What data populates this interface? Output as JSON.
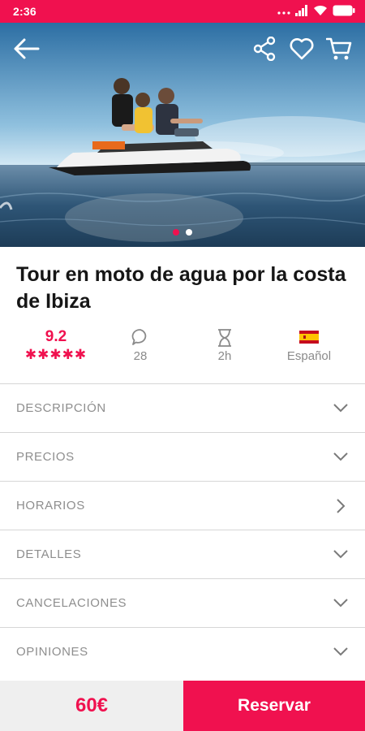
{
  "status_bar": {
    "time": "2:36",
    "bg_color": "#f0114f"
  },
  "hero": {
    "icons": [
      "back-arrow-icon",
      "share-icon",
      "heart-icon",
      "cart-icon"
    ],
    "slides_total": 2,
    "active_slide": 1
  },
  "title": "Tour en moto de agua por la costa de Ibiza",
  "stats": {
    "rating": "9.2",
    "stars": "✱✱✱✱✱",
    "reviews": "28",
    "duration": "2h",
    "language": "Español"
  },
  "sections": [
    {
      "label": "DESCRIPCIÓN",
      "icon": "chevron-down-icon"
    },
    {
      "label": "PRECIOS",
      "icon": "chevron-down-icon"
    },
    {
      "label": "HORARIOS",
      "icon": "chevron-right-icon"
    },
    {
      "label": "DETALLES",
      "icon": "chevron-down-icon"
    },
    {
      "label": "CANCELACIONES",
      "icon": "chevron-down-icon"
    },
    {
      "label": "OPINIONES",
      "icon": "chevron-down-icon"
    }
  ],
  "bottom": {
    "price": "60€",
    "book_label": "Reservar"
  },
  "colors": {
    "accent": "#f0114f",
    "muted": "#8e8e8e"
  }
}
